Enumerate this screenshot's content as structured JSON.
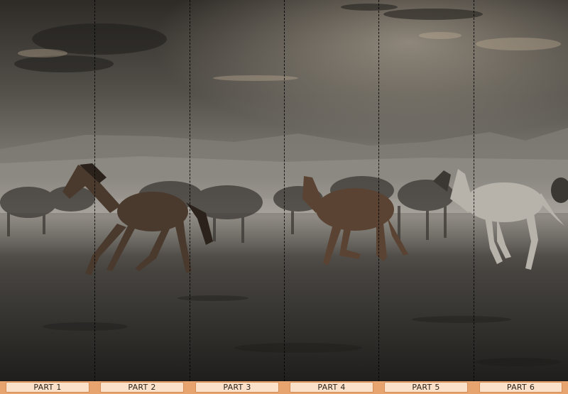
{
  "image": {
    "subject": "wild-horses-running",
    "colors": {
      "sky_top": "#3b3731",
      "sky_mid": "#8b8983",
      "haze": "#b9b5ad",
      "ground": "#2f2d2a"
    }
  },
  "footer": {
    "background": "#e7a46f",
    "label_background": "#fbe1c9",
    "parts": [
      "PART 1",
      "PART 2",
      "PART 3",
      "PART 4",
      "PART 5",
      "PART 6"
    ]
  }
}
